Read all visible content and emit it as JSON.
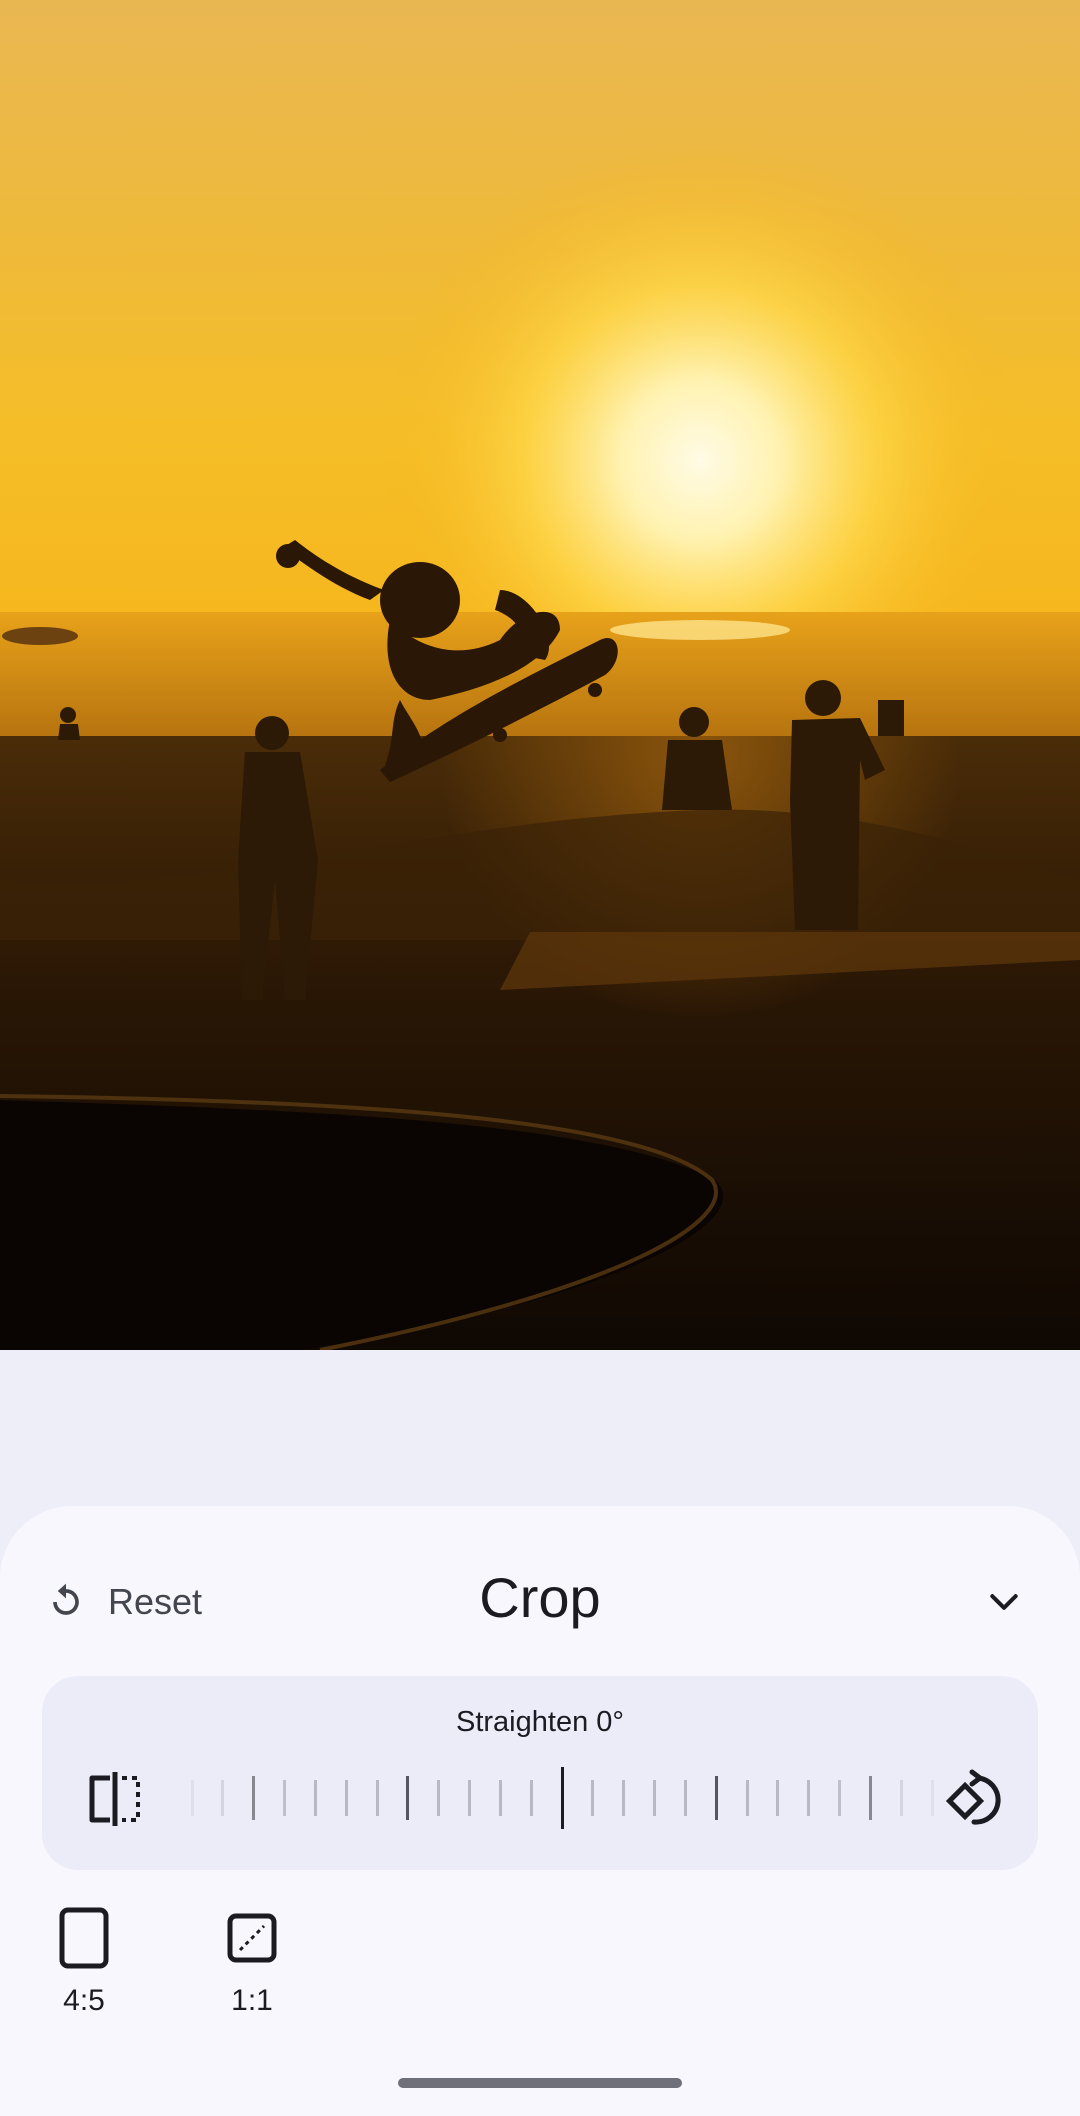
{
  "photo": {
    "subject": "skateboarder-silhouette-at-sunset"
  },
  "editor": {
    "reset_label": "Reset",
    "title": "Crop",
    "straighten_label": "Straighten 0°",
    "aspect_ratios": [
      {
        "label": "4:5"
      },
      {
        "label": "1:1"
      }
    ]
  },
  "icons": {
    "reset": "reset-icon",
    "collapse": "chevron-down-icon",
    "flip": "flip-horizontal-icon",
    "rotate": "rotate-icon",
    "ratio_4_5": "portrait-rectangle-icon",
    "ratio_1_1": "square-ratio-icon"
  },
  "colors": {
    "sheet_bg": "#f8f7fd",
    "card_bg": "#ececf9",
    "app_bg": "#eeeef9",
    "text": "#1b1b21"
  },
  "straighten_value_degrees": 0
}
